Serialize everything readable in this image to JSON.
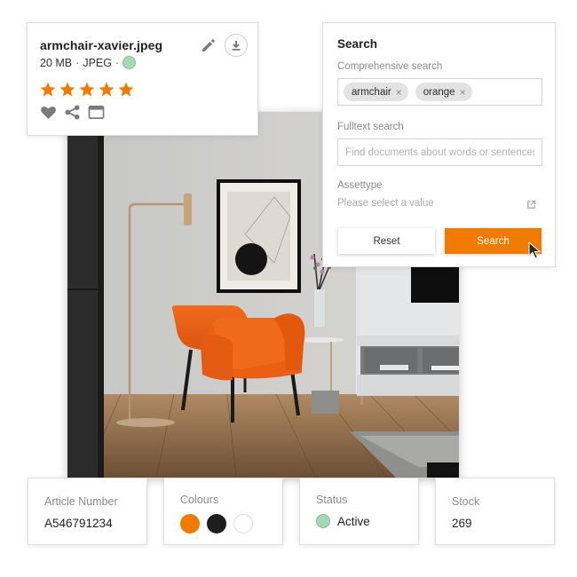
{
  "asset_card": {
    "filename": "armchair-xavier.jpeg",
    "size": "20 MB",
    "format": "JPEG",
    "separator": "·",
    "status_color": "#a5d8b3",
    "rating": 5,
    "rating_max": 5,
    "star_color": "#f07b00",
    "icons": [
      "edit-icon",
      "download-icon",
      "heart-icon",
      "share-icon",
      "window-icon"
    ]
  },
  "search": {
    "title": "Search",
    "comprehensive_label": "Comprehensive search",
    "chips": [
      {
        "label": "armchair",
        "remove": "×"
      },
      {
        "label": "orange",
        "remove": "×"
      }
    ],
    "fulltext_label": "Fulltext search",
    "fulltext_value": "",
    "fulltext_placeholder": "Find documents about words or sentences",
    "assettype_label": "Assettype",
    "assettype_placeholder": "Please select a value",
    "reset_label": "Reset",
    "search_label": "Search",
    "accent_color": "#f07b00"
  },
  "info": {
    "article": {
      "label": "Article Number",
      "value": "A546791234"
    },
    "colours": {
      "label": "Colours",
      "swatches": [
        "#f07b00",
        "#1e1e1e",
        "#ffffff"
      ]
    },
    "status": {
      "label": "Status",
      "value": "Active",
      "color": "#a5d8b3"
    },
    "stock": {
      "label": "Stock",
      "value": "269"
    }
  },
  "photo": {
    "subject": "orange armchair in living room"
  }
}
